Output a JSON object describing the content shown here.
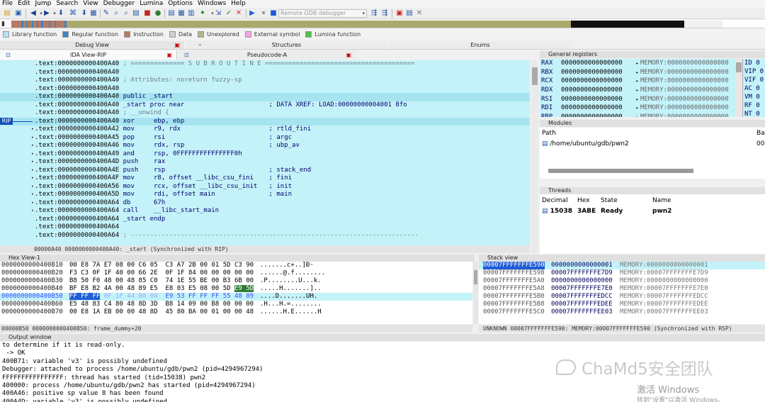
{
  "menu": [
    "File",
    "Edit",
    "Jump",
    "Search",
    "View",
    "Debugger",
    "Lumina",
    "Options",
    "Windows",
    "Help"
  ],
  "toolbar": {
    "debugger_select": "Remote GDB debugger"
  },
  "legend": [
    {
      "label": "Library function",
      "color": "#b6e1f5"
    },
    {
      "label": "Regular function",
      "color": "#3d85c6"
    },
    {
      "label": "Instruction",
      "color": "#b57b62"
    },
    {
      "label": "Data",
      "color": "#cfcfcf"
    },
    {
      "label": "Unexplored",
      "color": "#b3b38a"
    },
    {
      "label": "External symbol",
      "color": "#f4a4e8"
    },
    {
      "label": "Lumina function",
      "color": "#4fc248"
    }
  ],
  "tabs_top": {
    "debug_view": "Debug View",
    "structures": "Structures",
    "enums": "Enums"
  },
  "tabs_ida": {
    "ida_view": "IDA View-RIP",
    "pseudocode": "Pseudocode-A"
  },
  "ida": {
    "rip_label": "RIP",
    "lines": [
      {
        "addr": ".text:0000000000400A40",
        "text": " ; ============== S U B R O U T I N E =======================================",
        "comment": true
      },
      {
        "addr": ".text:0000000000400A40",
        "text": "",
        "comment": false
      },
      {
        "addr": ".text:0000000000400A40",
        "text": " ; Attributes: noreturn fuzzy-sp",
        "comment": true
      },
      {
        "addr": ".text:0000000000400A40",
        "text": "",
        "comment": false
      },
      {
        "addr": ".text:0000000000400A40",
        "text": " public _start",
        "comment": false
      },
      {
        "addr": ".text:0000000000400A40",
        "text": " _start proc near                      ; DATA XREF: LOAD:00000000004001 8fo",
        "comment": false
      },
      {
        "addr": ".text:0000000000400A40",
        "text": " ; __unwind {",
        "comment": true
      },
      {
        "addr": ".text:0000000000400A40",
        "text": " xor     ebp, ebp",
        "comment": false
      },
      {
        "addr": ".text:0000000000400A42",
        "text": " mov     r9, rdx                       ; rtld_fini",
        "comment": false
      },
      {
        "addr": ".text:0000000000400A45",
        "text": " pop     rsi                           ; argc",
        "comment": false
      },
      {
        "addr": ".text:0000000000400A46",
        "text": " mov     rdx, rsp                      ; ubp_av",
        "comment": false
      },
      {
        "addr": ".text:0000000000400A49",
        "text": " and     rsp, 0FFFFFFFFFFFFFFF0h",
        "comment": false
      },
      {
        "addr": ".text:0000000000400A4D",
        "text": " push    rax",
        "comment": false
      },
      {
        "addr": ".text:0000000000400A4E",
        "text": " push    rsp                           ; stack_end",
        "comment": false
      },
      {
        "addr": ".text:0000000000400A4F",
        "text": " mov     r8, offset __libc_csu_fini    ; fini",
        "comment": false
      },
      {
        "addr": ".text:0000000000400A56",
        "text": " mov     rcx, offset __libc_csu_init   ; init",
        "comment": false
      },
      {
        "addr": ".text:0000000000400A5D",
        "text": " mov     rdi, offset main              ; main",
        "comment": false
      },
      {
        "addr": ".text:0000000000400A64",
        "text": " db      67h",
        "comment": false
      },
      {
        "addr": ".text:0000000000400A64",
        "text": " call    __libc_start_main",
        "comment": false
      },
      {
        "addr": ".text:0000000000400A64",
        "text": " _start endp",
        "comment": false
      },
      {
        "addr": ".text:0000000000400A64",
        "text": "",
        "comment": false
      },
      {
        "addr": ".text:0000000000400A64",
        "text": " ; ---------------------------------------------------------------------------",
        "comment": true
      }
    ],
    "status": "00000A40 0000000000400A40: _start (Synchronized with RIP)"
  },
  "registers": {
    "title": "General registers",
    "rows": [
      {
        "name": "RAX",
        "value": "0000000000000000",
        "mem": "MEMORY:0000000000000000"
      },
      {
        "name": "RBX",
        "value": "0000000000000000",
        "mem": "MEMORY:0000000000000000"
      },
      {
        "name": "RCX",
        "value": "0000000000000000",
        "mem": "MEMORY:0000000000000000"
      },
      {
        "name": "RDX",
        "value": "0000000000000000",
        "mem": "MEMORY:0000000000000000"
      },
      {
        "name": "RSI",
        "value": "0000000000000000",
        "mem": "MEMORY:0000000000000000"
      },
      {
        "name": "RDI",
        "value": "0000000000000000",
        "mem": "MEMORY:0000000000000000"
      },
      {
        "name": "RBP",
        "value": "0000000000000000",
        "mem": "MEMORY:0000000000000000"
      }
    ],
    "flags": [
      "ID 0",
      "VIP 0",
      "VIF 0",
      "AC 0",
      "VM 0",
      "RF 0",
      "NT 0"
    ]
  },
  "modules": {
    "title": "Modules",
    "col_path": "Path",
    "col_base": "Bas",
    "row_path": "/home/ubuntu/gdb/pwn2",
    "row_base": "000"
  },
  "threads": {
    "title": "Threads",
    "cols": [
      "Decimal",
      "Hex",
      "State",
      "Name"
    ],
    "row": [
      "15038",
      "3ABE",
      "Ready",
      "pwn2"
    ]
  },
  "hex": {
    "title": "Hex View-1",
    "rows": [
      {
        "addr": "0000000000400B10",
        "bytes": "00 E8 7A E7 08 00 C6 05  C3 A7 2B 00 01 5D C3 90",
        "ascii": ".......c+..]Đ·"
      },
      {
        "addr": "0000000000400B20",
        "bytes": "F3 C3 0F 1F 40 00 66 2E  0F 1F 84 00 00 00 00 00",
        "ascii": "......@.f........"
      },
      {
        "addr": "0000000000400B30",
        "bytes": "B8 50 F0 48 00 48 85 C0  74 1E 55 BE 00 B3 6B 00",
        "ascii": ".P........U...k."
      },
      {
        "addr": "0000000000400B40",
        "bytes": "BF E8 B2 4A 00 48 89 E5  E8 03 E5 08 00 5D E9 5D",
        "ascii": ".....H.......]..",
        "mark": "E9 5D"
      },
      {
        "addr": "0000000000400B50",
        "bytes": "FF FF FF 0F 1F 44 00 00  E9 53 FF FF FF 55 48 89",
        "ascii": "....D.......UH.",
        "current": true
      },
      {
        "addr": "0000000000400B60",
        "bytes": "E5 48 83 C4 80 48 8D 3D  B8 14 09 00 B8 00 00 00",
        "ascii": ".H...H.=........"
      },
      {
        "addr": "0000000000400B70",
        "bytes": "00 E8 1A EB 00 00 48 8D  45 80 BA 00 01 00 00 48",
        "ascii": "......H.E......H"
      }
    ],
    "status": "00000B50 0000000000400B50: frame_dummy+20"
  },
  "stack": {
    "title": "Stack view",
    "rows": [
      {
        "addr": "00007FFFFFFFE590",
        "value": "0000000000000001",
        "mem": "MEMORY:0000000000000001",
        "current": true
      },
      {
        "addr": "00007FFFFFFFE598",
        "value": "00007FFFFFFFE7D9",
        "mem": "MEMORY:00007FFFFFFFE7D9"
      },
      {
        "addr": "00007FFFFFFFE5A0",
        "value": "0000000000000000",
        "mem": "MEMORY:0000000000000000"
      },
      {
        "addr": "00007FFFFFFFE5A8",
        "value": "00007FFFFFFFE7E0",
        "mem": "MEMORY:00007FFFFFFFE7E0"
      },
      {
        "addr": "00007FFFFFFFE5B0",
        "value": "00007FFFFFFFEDCC",
        "mem": "MEMORY:00007FFFFFFFEDCC"
      },
      {
        "addr": "00007FFFFFFFE5B8",
        "value": "00007FFFFFFFEDEE",
        "mem": "MEMORY:00007FFFFFFFEDEE"
      },
      {
        "addr": "00007FFFFFFFE5C0",
        "value": "00007FFFFFFFEE03",
        "mem": "MEMORY:00007FFFFFFFEE03"
      }
    ],
    "status": "UNKNOWN 00007FFFFFFFE590: MEMORY:00007FFFFFFFE590 (Synchronized with RSP)"
  },
  "output": {
    "title": "Output window",
    "lines": [
      "to determine if it is read-only.",
      " -> OK",
      "400B71: variable 'v3' is possibly undefined",
      "Debugger: attached to process /home/ubuntu/gdb/pwn2 (pid=4294967294)",
      "FFFFFFFFFFFFFFFF: thread has started (tid=15038) pwn2",
      "400000: process /home/ubuntu/gdb/pwn2 has started (pid=4294967294)",
      "400A46: positive sp value 8 has been found",
      "400A4D: variable 'v3' is possibly undefined"
    ]
  },
  "watermark": {
    "brand": "ChaMd5安全团队",
    "activate": "激活 Windows",
    "activate_sub": "转到\"设置\"以激活 Windows。"
  }
}
